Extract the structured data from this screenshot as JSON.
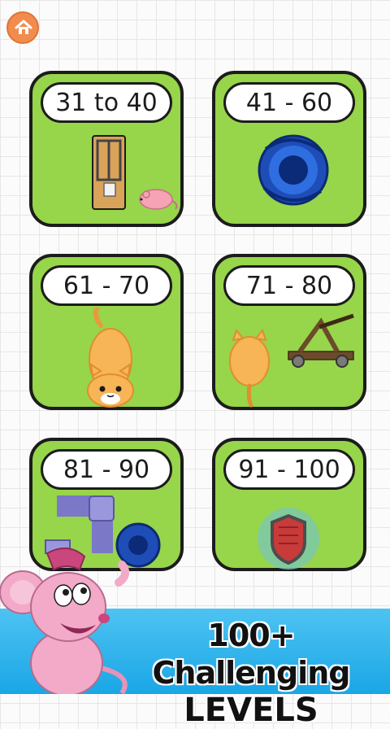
{
  "home_icon": "home-icon",
  "level_cards": [
    {
      "label": "31 to 40",
      "icon": "mouse-trap-icon"
    },
    {
      "label": "41 - 60",
      "icon": "black-hole-icon"
    },
    {
      "label": "61 - 70",
      "icon": "cat-icon"
    },
    {
      "label": "71 - 80",
      "icon": "catapult-icon"
    },
    {
      "label": "81 - 90",
      "icon": "pipe-icon"
    },
    {
      "label": "91 - 100",
      "icon": "shield-icon"
    }
  ],
  "banner": {
    "line1": "100+ Challenging",
    "line2": "LEVELS"
  },
  "colors": {
    "card_bg": "#97d54a",
    "banner_bg": "#1aa6e6",
    "home_button": "#f28b4e"
  }
}
